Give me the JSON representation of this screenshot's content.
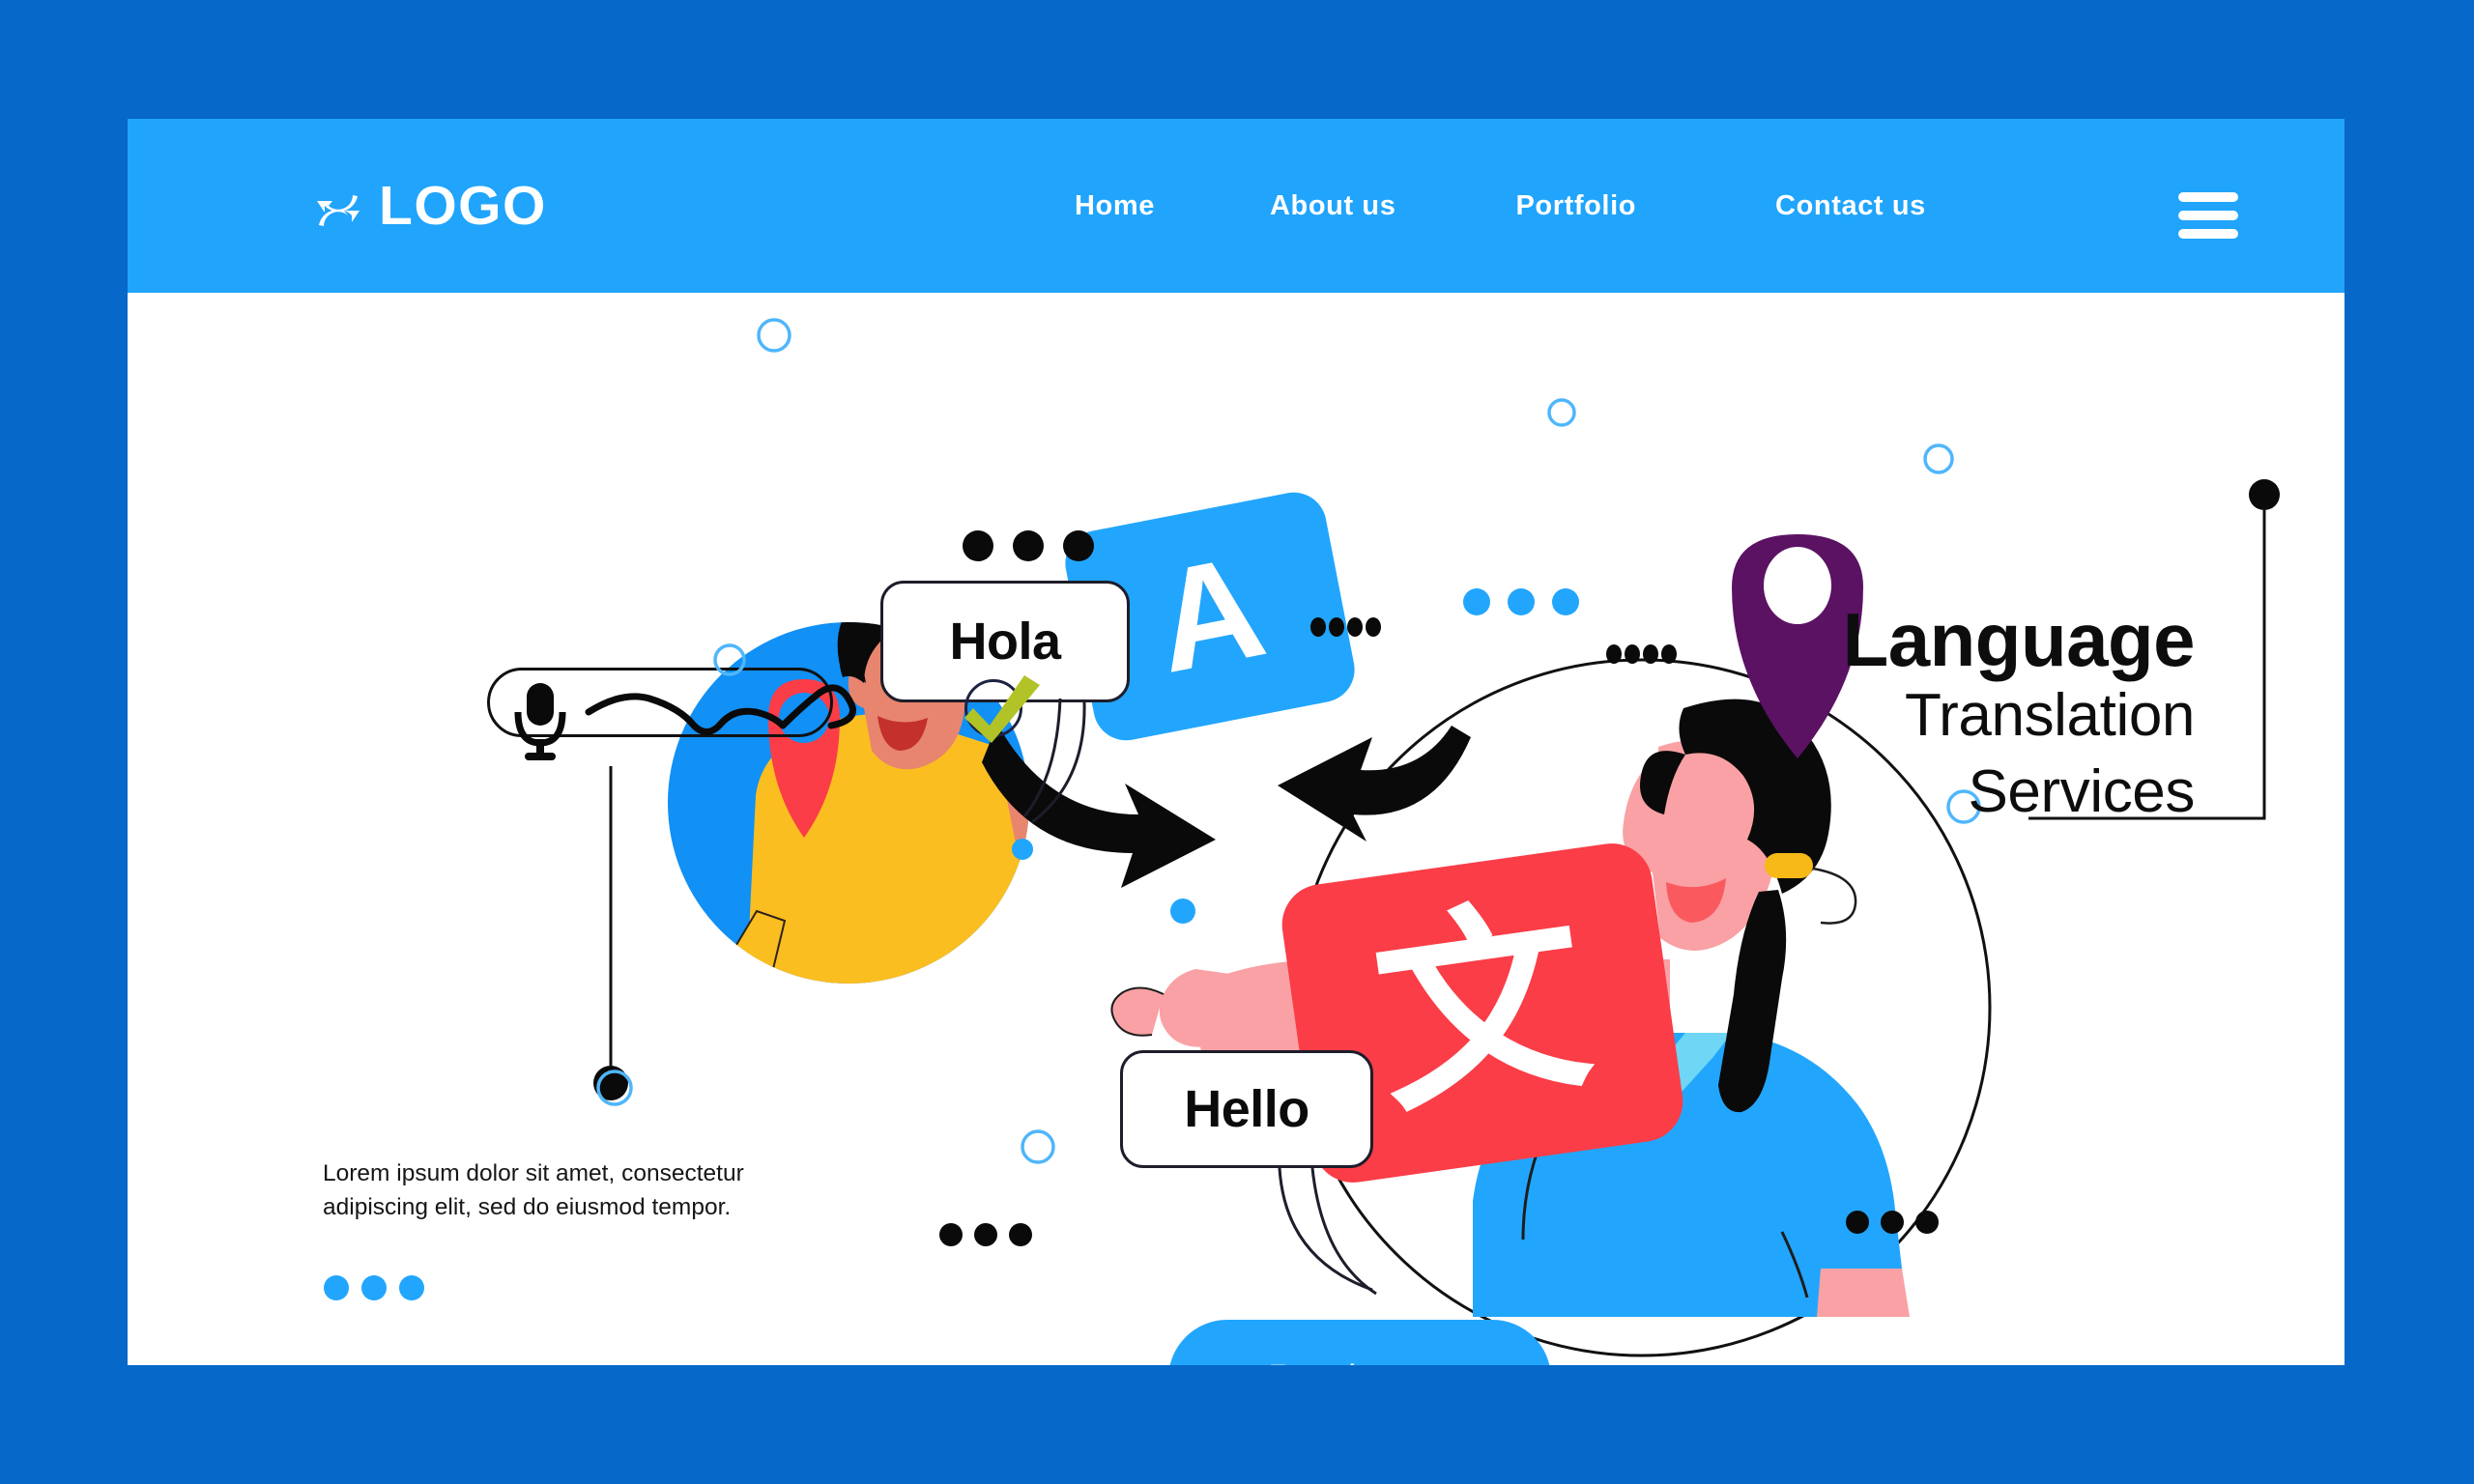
{
  "theme": {
    "page_background": "#0668C8",
    "card_background": "#FFFFFF",
    "header_background": "#20A4FC",
    "accent_blue": "#22A6FD",
    "accent_red": "#FA3D47",
    "accent_purple": "#5B1263",
    "accent_green": "#B2C327",
    "accent_yellow": "#FBBE20",
    "text_dark": "#0D0D0D"
  },
  "header": {
    "logo": {
      "icon": "sync-arrows-icon",
      "text": "LOGO"
    },
    "nav": [
      {
        "label": "Home"
      },
      {
        "label": "About us"
      },
      {
        "label": "Portfolio"
      },
      {
        "label": "Contact us"
      }
    ],
    "menu_icon": "hamburger-menu-icon"
  },
  "hero": {
    "headline_line1": "Language",
    "headline_line2": "Translation",
    "headline_line3": "Services",
    "body_text": "Lorem ipsum dolor sit amet, consectetur adipiscing elit, sed do eiusmod tempor.",
    "cta_label": "Read more"
  },
  "illustration": {
    "voice_input": {
      "icon": "microphone-icon",
      "waveform": "sound-wave-icon"
    },
    "bubbles": [
      {
        "name": "speech-bubble-hola",
        "text": "Hola"
      },
      {
        "name": "speech-bubble-hello",
        "text": "Hello"
      }
    ],
    "language_cards": [
      {
        "name": "language-card-latin",
        "glyph": "A",
        "color": "#22A6FD"
      },
      {
        "name": "language-card-chinese",
        "glyph": "文",
        "color": "#FA3D47"
      }
    ],
    "badges": [
      {
        "name": "check-badge-top",
        "icon": "check-icon"
      },
      {
        "name": "check-badge-bottom",
        "icon": "check-icon"
      }
    ],
    "pins": [
      {
        "name": "location-pin-red",
        "color": "#FA3D47"
      },
      {
        "name": "location-pin-purple",
        "color": "#5B1263"
      }
    ],
    "arrows": [
      {
        "name": "arrow-left-curved"
      },
      {
        "name": "arrow-right-curved"
      }
    ],
    "people": [
      {
        "name": "person-left-man",
        "shirt_color": "#FBBE20",
        "circle_color": "#1190F5"
      },
      {
        "name": "person-right-woman",
        "shirt_color": "#22A6FD",
        "skin_color": "#F9A1A4"
      }
    ]
  }
}
